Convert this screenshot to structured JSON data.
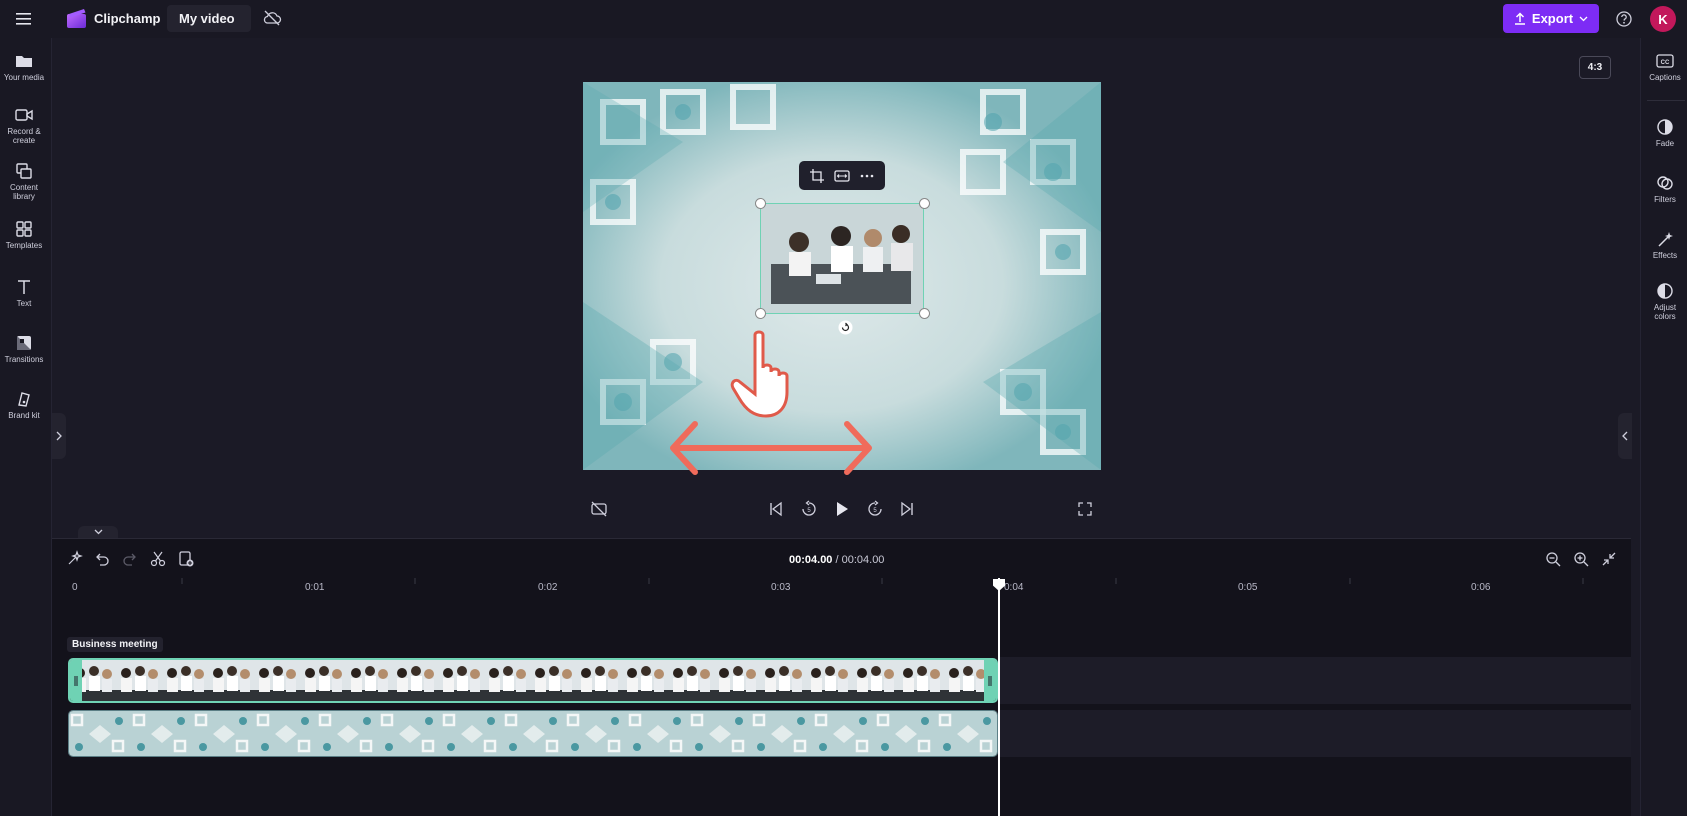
{
  "header": {
    "brand": "Clipchamp",
    "project_title": "My video",
    "export_label": "Export",
    "avatar_initial": "K",
    "accent": "#7d2cf5"
  },
  "left_sidebar": {
    "items": [
      {
        "label": "Your media",
        "icon": "folder-icon"
      },
      {
        "label": "Record & create",
        "icon": "camera-icon"
      },
      {
        "label": "Content library",
        "icon": "library-icon"
      },
      {
        "label": "Templates",
        "icon": "templates-icon"
      },
      {
        "label": "Text",
        "icon": "text-icon"
      },
      {
        "label": "Transitions",
        "icon": "transitions-icon"
      },
      {
        "label": "Brand kit",
        "icon": "brand-kit-icon"
      }
    ]
  },
  "right_sidebar": {
    "items": [
      {
        "label": "Captions",
        "icon": "captions-icon"
      },
      {
        "label": "Fade",
        "icon": "fade-icon"
      },
      {
        "label": "Filters",
        "icon": "filters-icon"
      },
      {
        "label": "Effects",
        "icon": "effects-icon"
      },
      {
        "label": "Adjust colors",
        "icon": "adjust-colors-icon"
      }
    ]
  },
  "preview": {
    "aspect_ratio": "4:3"
  },
  "timeline": {
    "current_time": "00:04.00",
    "separator": " / ",
    "total_time": "00:04.00",
    "ticks": [
      "0",
      "0:01",
      "0:02",
      "0:03",
      "0:04",
      "0:05",
      "0:06"
    ],
    "clip_label": "Business meeting"
  }
}
